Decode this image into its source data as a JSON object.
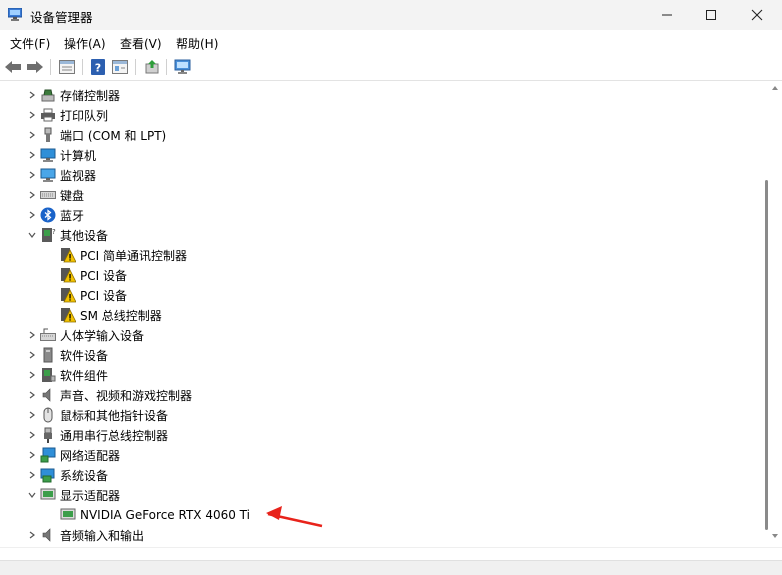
{
  "window": {
    "title": "设备管理器"
  },
  "menu": [
    "文件(F)",
    "操作(A)",
    "查看(V)",
    "帮助(H)"
  ],
  "tree": {
    "categories": [
      {
        "label": "存储控制器",
        "icon": "storage-controller-icon",
        "expanded": false
      },
      {
        "label": "打印队列",
        "icon": "printer-icon",
        "expanded": false
      },
      {
        "label": "端口 (COM 和 LPT)",
        "icon": "port-icon",
        "expanded": false
      },
      {
        "label": "计算机",
        "icon": "computer-icon",
        "expanded": false
      },
      {
        "label": "监视器",
        "icon": "monitor-icon",
        "expanded": false
      },
      {
        "label": "键盘",
        "icon": "keyboard-icon",
        "expanded": false
      },
      {
        "label": "蓝牙",
        "icon": "bluetooth-icon",
        "expanded": false
      },
      {
        "label": "其他设备",
        "icon": "other-devices-icon",
        "expanded": true
      },
      {
        "label": "人体学输入设备",
        "icon": "hid-icon",
        "expanded": false
      },
      {
        "label": "软件设备",
        "icon": "software-device-icon",
        "expanded": false
      },
      {
        "label": "软件组件",
        "icon": "software-component-icon",
        "expanded": false
      },
      {
        "label": "声音、视频和游戏控制器",
        "icon": "speaker-icon",
        "expanded": false
      },
      {
        "label": "鼠标和其他指针设备",
        "icon": "mouse-icon",
        "expanded": false
      },
      {
        "label": "通用串行总线控制器",
        "icon": "usb-icon",
        "expanded": false
      },
      {
        "label": "网络适配器",
        "icon": "network-adapter-icon",
        "expanded": false
      },
      {
        "label": "系统设备",
        "icon": "system-device-icon",
        "expanded": false
      },
      {
        "label": "显示适配器",
        "icon": "display-adapter-icon",
        "expanded": true
      },
      {
        "label": "音频输入和输出",
        "icon": "audio-io-icon",
        "expanded": false
      }
    ],
    "other_devices": [
      "PCI 简单通讯控制器",
      "PCI 设备",
      "PCI 设备",
      "SM 总线控制器"
    ],
    "display_adapters": [
      "NVIDIA GeForce RTX 4060 Ti"
    ]
  },
  "colors": {
    "titlebar": "#f3f3f3",
    "warning": "#f2c200",
    "annotation_arrow": "#e8231b"
  }
}
